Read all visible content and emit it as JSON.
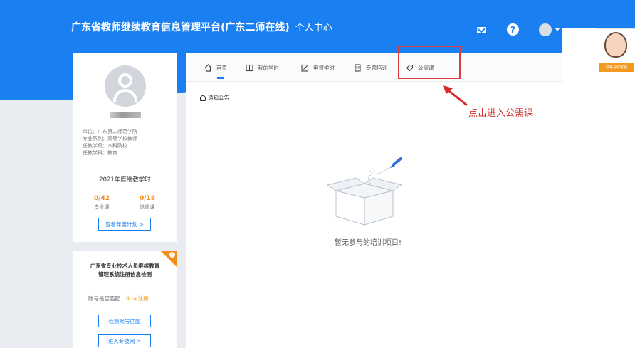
{
  "header": {
    "title": "广东省教师继续教育信息管理平台(广东二师在线)",
    "subtitle": "个人中心",
    "icons": [
      "mail-icon",
      "help-icon",
      "user-avatar-icon"
    ],
    "help_glyph": "?"
  },
  "customer_service": {
    "label": "联系在线客服"
  },
  "profile": {
    "info_lines": [
      "单位：广东第二师范学院",
      "专业系列：高等学校教师",
      "任教学段：本科院校",
      "任教学科：教育"
    ],
    "year_title": "2021年度继教学时",
    "stats": [
      {
        "value": "0/42",
        "label": "专业课"
      },
      {
        "value": "0/18",
        "label": "选修课"
      }
    ],
    "plan_button": "查看年度计划 >"
  },
  "registration_check": {
    "title_line1": "广东省专业技术人员继续教育",
    "title_line2": "管理系统注册信息检测",
    "match_label": "账号是否匹配",
    "match_status": "① 未注册",
    "check_button": "检测账号匹配",
    "enter_button": "进入专技网 >"
  },
  "tabs": [
    {
      "label": "首页",
      "icon": "home-icon"
    },
    {
      "label": "我的学时",
      "icon": "book-icon"
    },
    {
      "label": "申报学时",
      "icon": "edit-icon"
    },
    {
      "label": "专题培训",
      "icon": "bookmark-icon"
    },
    {
      "label": "公需课",
      "icon": "tag-icon"
    }
  ],
  "notice": {
    "label": "通知公告"
  },
  "annotation": {
    "text": "点击进入公需课"
  },
  "empty_state": {
    "text": "暂无参与的培训项目!"
  },
  "colors": {
    "brand_blue": "#1a7ff0",
    "accent_orange": "#f08a1a",
    "annotation_red": "#d62a2a"
  }
}
